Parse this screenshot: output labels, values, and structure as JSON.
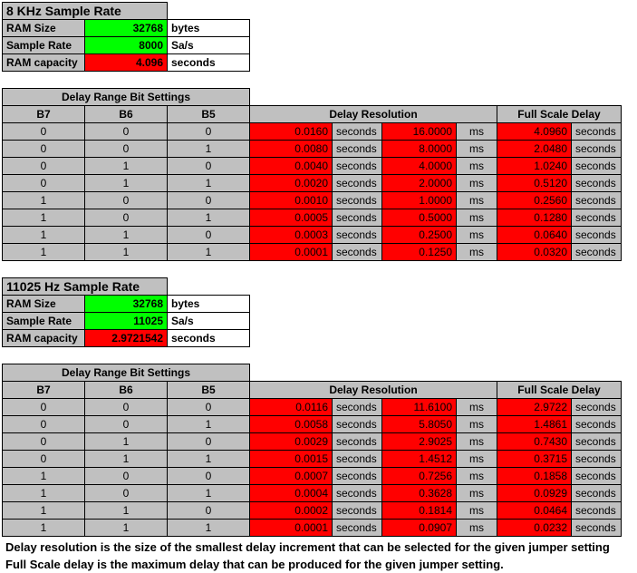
{
  "labels": {
    "ram_size": "RAM Size",
    "sample_rate": "Sample Rate",
    "ram_capacity": "RAM capacity",
    "bytes": "bytes",
    "sas": "Sa/s",
    "seconds": "seconds",
    "ms": "ms",
    "delay_range_bit_settings": "Delay Range Bit Settings",
    "b7": "B7",
    "b6": "B6",
    "b5": "B5",
    "delay_resolution": "Delay Resolution",
    "full_scale_delay": "Full Scale Delay"
  },
  "sections": [
    {
      "title": "8 KHz Sample Rate",
      "ram_size": "32768",
      "sample_rate": "8000",
      "ram_capacity": "4.096",
      "rows": [
        {
          "b7": "0",
          "b6": "0",
          "b5": "0",
          "res_s": "0.0160",
          "res_ms": "16.0000",
          "full": "4.0960"
        },
        {
          "b7": "0",
          "b6": "0",
          "b5": "1",
          "res_s": "0.0080",
          "res_ms": "8.0000",
          "full": "2.0480"
        },
        {
          "b7": "0",
          "b6": "1",
          "b5": "0",
          "res_s": "0.0040",
          "res_ms": "4.0000",
          "full": "1.0240"
        },
        {
          "b7": "0",
          "b6": "1",
          "b5": "1",
          "res_s": "0.0020",
          "res_ms": "2.0000",
          "full": "0.5120"
        },
        {
          "b7": "1",
          "b6": "0",
          "b5": "0",
          "res_s": "0.0010",
          "res_ms": "1.0000",
          "full": "0.2560"
        },
        {
          "b7": "1",
          "b6": "0",
          "b5": "1",
          "res_s": "0.0005",
          "res_ms": "0.5000",
          "full": "0.1280"
        },
        {
          "b7": "1",
          "b6": "1",
          "b5": "0",
          "res_s": "0.0003",
          "res_ms": "0.2500",
          "full": "0.0640"
        },
        {
          "b7": "1",
          "b6": "1",
          "b5": "1",
          "res_s": "0.0001",
          "res_ms": "0.1250",
          "full": "0.0320"
        }
      ]
    },
    {
      "title": "11025 Hz Sample Rate",
      "ram_size": "32768",
      "sample_rate": "11025",
      "ram_capacity": "2.9721542",
      "rows": [
        {
          "b7": "0",
          "b6": "0",
          "b5": "0",
          "res_s": "0.0116",
          "res_ms": "11.6100",
          "full": "2.9722"
        },
        {
          "b7": "0",
          "b6": "0",
          "b5": "1",
          "res_s": "0.0058",
          "res_ms": "5.8050",
          "full": "1.4861"
        },
        {
          "b7": "0",
          "b6": "1",
          "b5": "0",
          "res_s": "0.0029",
          "res_ms": "2.9025",
          "full": "0.7430"
        },
        {
          "b7": "0",
          "b6": "1",
          "b5": "1",
          "res_s": "0.0015",
          "res_ms": "1.4512",
          "full": "0.3715"
        },
        {
          "b7": "1",
          "b6": "0",
          "b5": "0",
          "res_s": "0.0007",
          "res_ms": "0.7256",
          "full": "0.1858"
        },
        {
          "b7": "1",
          "b6": "0",
          "b5": "1",
          "res_s": "0.0004",
          "res_ms": "0.3628",
          "full": "0.0929"
        },
        {
          "b7": "1",
          "b6": "1",
          "b5": "0",
          "res_s": "0.0002",
          "res_ms": "0.1814",
          "full": "0.0464"
        },
        {
          "b7": "1",
          "b6": "1",
          "b5": "1",
          "res_s": "0.0001",
          "res_ms": "0.0907",
          "full": "0.0232"
        }
      ]
    }
  ],
  "footer_line1": "Delay resolution is the size of the smallest delay increment that can be selected for the given jumper setting",
  "footer_line2": "Full Scale delay is the maximum delay that can be produced for the given jumper setting."
}
